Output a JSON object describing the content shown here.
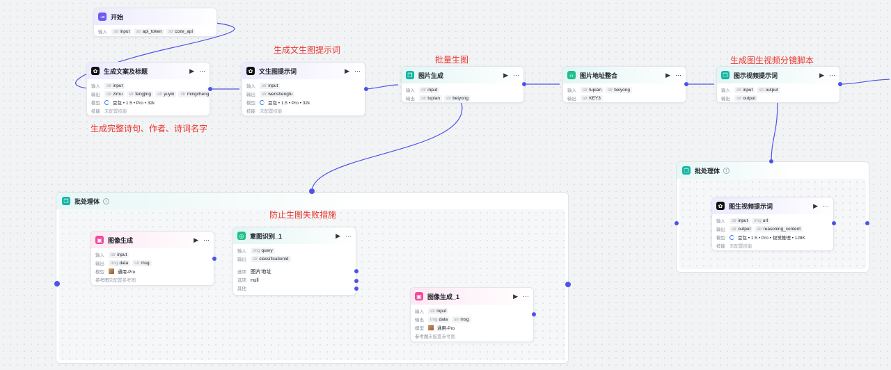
{
  "annotations": {
    "a1": "生成文生图提示词",
    "a2": "批量生图",
    "a3": "生成图生视频分镜脚本",
    "a4": "生成完整诗句、作者、诗词名字",
    "a5": "防止生图失败措施"
  },
  "labels": {
    "input": "输入",
    "output": "输出",
    "model": "模型",
    "skill": "技能",
    "refimg": "参考图",
    "option": "选项",
    "other": "其他"
  },
  "common": {
    "no_skill": "未配置技能",
    "no_refimg": "未配置参考图",
    "model_pro32k": "豆包 • 1.5 • Pro • 32k",
    "model_vision": "豆包 • 1.5 • Pro • 视觉推理 • 128K",
    "model_tongyong": "通用-Pro"
  },
  "start": {
    "title": "开始",
    "inputs": [
      "api_token",
      "coze_api"
    ],
    "first_input": "input"
  },
  "n1": {
    "title": "生成文案及标题",
    "in": [
      "input"
    ],
    "out": [
      "zimu",
      "fengjing",
      "yuyin",
      "mingcheng"
    ]
  },
  "n2": {
    "title": "文生图提示词",
    "in": [
      "input"
    ],
    "out": [
      "wenshengtu"
    ]
  },
  "n3": {
    "title": "图片生成",
    "in": [
      "input"
    ],
    "out": [
      "tupian",
      "beiyong"
    ]
  },
  "n4": {
    "title": "图片地址整合",
    "in": [
      "tupian",
      "beiyong"
    ],
    "out": [
      "KEY3"
    ]
  },
  "n5": {
    "title": "图示视频提示词",
    "in": [
      "input",
      "output"
    ],
    "out": [
      "output"
    ]
  },
  "g1": {
    "title": "批处理体"
  },
  "g2": {
    "title": "批处理体"
  },
  "n6": {
    "title": "图像生成",
    "in": [
      "input"
    ],
    "out": [
      "data",
      "msg"
    ]
  },
  "n7": {
    "title": "意图识别_1",
    "in": [
      "query"
    ],
    "out": [
      "classificationId"
    ],
    "options": [
      "图片地址",
      "null"
    ]
  },
  "n8": {
    "title": "图像生成_1",
    "in": [
      "input"
    ],
    "out": [
      "data",
      "msg"
    ]
  },
  "n9": {
    "title": "图生视频提示词",
    "in": [
      "input",
      "url"
    ],
    "out": [
      "output",
      "reasoning_content"
    ]
  },
  "type_tags": {
    "str": "str",
    "img": "img"
  },
  "icons": {
    "run": "play-icon",
    "more": "more-icon"
  },
  "colors": {
    "edge": "#4d53e8",
    "annotation": "#e8332a"
  }
}
